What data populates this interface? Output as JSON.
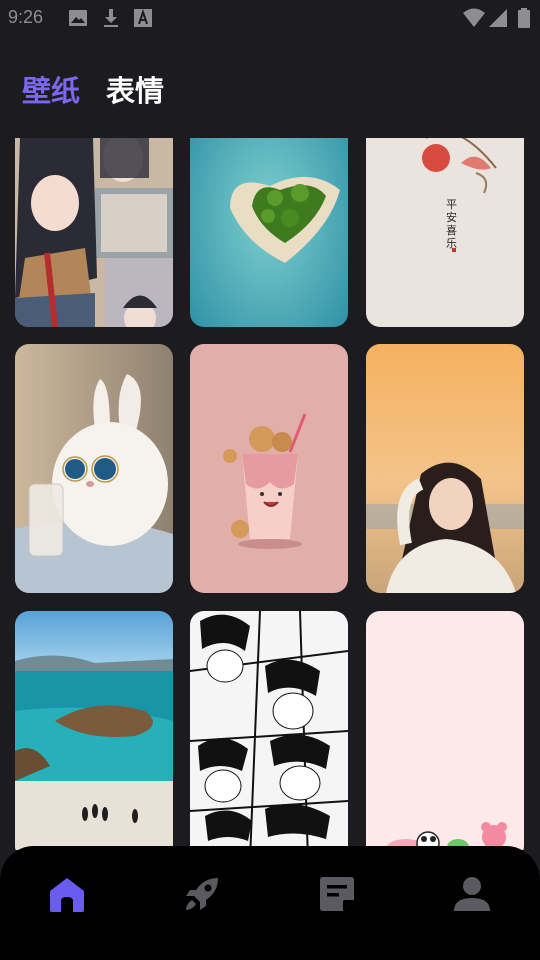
{
  "status_bar": {
    "time": "9:26",
    "left_icons": [
      "image-icon",
      "download-icon",
      "font-icon"
    ],
    "right_icons": [
      "wifi-icon",
      "signal-icon",
      "battery-icon"
    ]
  },
  "tabs": [
    {
      "label": "壁纸",
      "active": true
    },
    {
      "label": "表情",
      "active": false
    }
  ],
  "wallpapers": [
    {
      "subject": "anime-girl-collage"
    },
    {
      "subject": "heart-island-ocean"
    },
    {
      "subject": "pomegranate-calligraphy",
      "text": "平安喜乐"
    },
    {
      "subject": "white-bunny-with-milk"
    },
    {
      "subject": "strawberry-milkshake-cookies"
    },
    {
      "subject": "girl-at-beach-sunset"
    },
    {
      "subject": "beach-with-penguins"
    },
    {
      "subject": "manga-faces-collage"
    },
    {
      "subject": "pink-cartoon-characters"
    }
  ],
  "bottom_nav": [
    {
      "name": "home",
      "icon": "home-icon",
      "active": true
    },
    {
      "name": "rocket",
      "icon": "rocket-icon",
      "active": false
    },
    {
      "name": "notes",
      "icon": "note-icon",
      "active": false
    },
    {
      "name": "profile",
      "icon": "person-icon",
      "active": false
    }
  ],
  "colors": {
    "background": "#1c1c20",
    "accent": "#7b68ee",
    "nav_bg": "#000000",
    "nav_inactive": "#5a5a60"
  }
}
